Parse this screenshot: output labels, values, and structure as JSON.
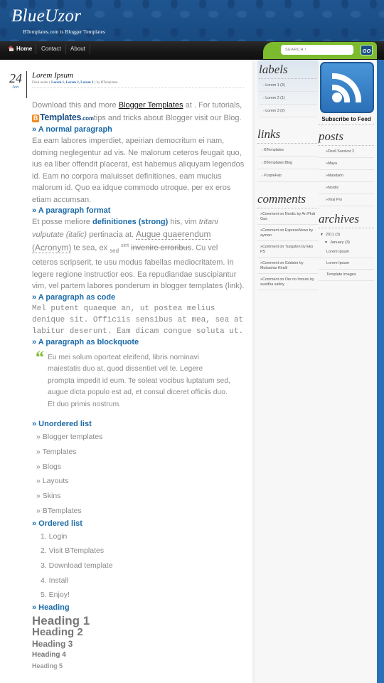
{
  "header": {
    "title": "BlueUzor",
    "description": "BTemplates.com is Blogger Templates"
  },
  "nav": {
    "items": [
      {
        "label": "Home",
        "icon": "home-icon"
      },
      {
        "label": "Contact"
      },
      {
        "label": "About"
      }
    ],
    "search_placeholder": "SEARCH !",
    "go_label": "GO"
  },
  "post": {
    "day": "24",
    "month": "Jan",
    "title": "Lorem Ipsum",
    "meta_prefix": "Filed under (",
    "meta_labels": [
      "Lorem 1",
      "Lorem 2",
      "Lorem 3"
    ],
    "meta_suffix": ") by BTemplates",
    "intro_1": "Download this and more ",
    "intro_link": "Blogger Templates",
    "intro_2": " at . For tutorials, ",
    "intro_logo": "Templates",
    "intro_logo_b": "B",
    "intro_logo_com": ".com",
    "intro_3": "tips and tricks about Blogger visit our Blog.",
    "sections": {
      "normal_title": "» A normal paragraph",
      "normal_text": "Ea eam labores imperdiet, apeirian democritum ei nam, doming neglegentur ad vis. Ne malorum ceteros feugait quo, ius ea liber offendit placerat, est habemus aliquyam legendos id. Eam no corpora maluisset definitiones, eam mucius malorum id. Quo ea idque commodo utroque, per ex eros etiam accumsan.",
      "format_title": "» A paragraph format",
      "format_1": "Et posse meliore ",
      "format_strong": "definitiones (strong)",
      "format_2": " his, vim ",
      "format_italic": "tritani vulputate (italic)",
      "format_3": " pertinacia at. ",
      "format_abbr": "Augue quaerendum (Acronym)",
      "format_4": " te sea, ex ",
      "format_sub": "sed",
      "format_sup": "sint",
      "format_strike": "invenire erroribus",
      "format_5": ". Cu vel ceteros scripserit, te usu modus fabellas mediocritatem. In legere regione instructior eos. Ea repudiandae suscipiantur vim, vel partem labores ponderum in blogger templates (link).",
      "code_title": "» A paragraph as code",
      "code_text": "Mel putent quaeque an, ut postea melius\ndenique sit. Officiis sensibus at mea, sea at\nlabitur deserunt. Eam dicam congue soluta ut.",
      "quote_title": "» A paragraph as blockquote",
      "quote_mark": "“",
      "quote_text": "Eu mei solum oporteat eleifend, libris nominavi maiestatis duo at, quod dissentiet vel te. Legere prompta impedit id eum. Te soleat vocibus luptatum sed, augue dicta populo est ad, et consul diceret officiis duo. Et duo primis nostrum.",
      "ul_title": "» Unordered list",
      "ul_items": [
        "» Blogger templates",
        "» Templates",
        "» Blogs",
        "» Layouts",
        "» Skins",
        "» BTemplates"
      ],
      "ol_title": "» Ordered list",
      "ol_items": [
        "1. Login",
        "2. Visit BTemplates",
        "3. Download template",
        "4. Install",
        "5. Enjoy!"
      ],
      "heading_title": "» Heading",
      "headings": [
        "Heading 1",
        "Heading 2",
        "Heading 3",
        "Heading 4",
        "Heading 5"
      ]
    }
  },
  "sidebar": {
    "labels": {
      "title": "labels",
      "items": [
        "Lorem 1 (3)",
        "Lorem 2 (1)",
        "Lorem 3 (2)"
      ]
    },
    "links": {
      "title": "links",
      "items": [
        "BTemplates",
        "BTemplates Blog",
        "PurpleFab"
      ]
    },
    "comments": {
      "title": "comments",
      "items": [
        "Comment on Nordic by An Phát Gas",
        "Comment on ExpressNews by ayman",
        "Comment on Tungsten by Eko PS",
        "Comment on Gridster by Mubashar Khalil",
        "Comment on Ore no Imouto by suvidha safety"
      ]
    },
    "feed": {
      "label": "Subscribe to Feed",
      "icon": "rss-icon"
    },
    "posts": {
      "title": "posts",
      "items": [
        "Devil Survivor 2",
        "Maya",
        "Mandarin",
        "Nordic",
        "Viral Pro"
      ]
    },
    "archives": {
      "title": "archives",
      "year": "2011 (3)",
      "month": "January (3)",
      "items": [
        "Lorem Ipsum",
        "Lorem Ipsum",
        "Template images"
      ]
    }
  },
  "colors": {
    "header_blue": "#1c4e84",
    "accent_blue": "#1a6aa8",
    "page_blue": "#2a70b8",
    "search_green": "#7cbb2d",
    "nav_black": "#161616"
  }
}
